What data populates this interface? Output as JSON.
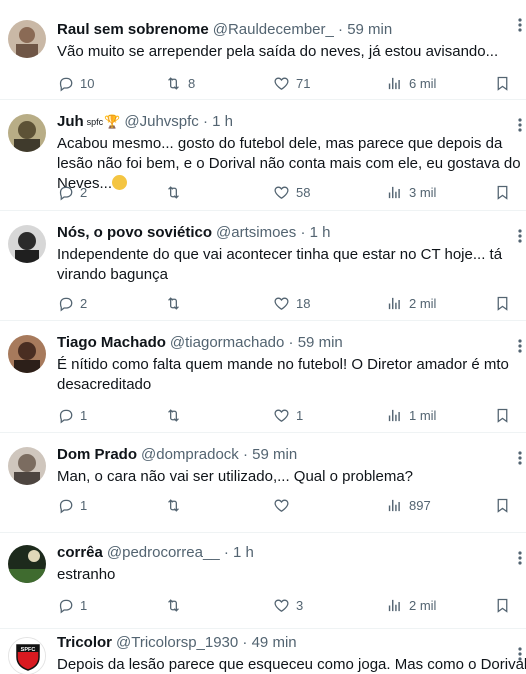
{
  "tweets": [
    {
      "name": "Raul sem sobrenome",
      "handle": "@Rauldecember_",
      "dot": "·",
      "time": "59 min",
      "text": "Vão muito se arrepender pela saída do neves, já estou avisando...",
      "replies": "10",
      "retweets": "8",
      "likes": "71",
      "views": "6 mil",
      "avatar_color": "#a58d78"
    },
    {
      "name": "Juh",
      "badge": "spfc",
      "handle": "@Juhvspfc",
      "dot": "·",
      "time": "1 h",
      "text": "Acabou mesmo... gosto do futebol dele, mas parece que depois da lesão não foi bem, e o Dorival não conta mais com ele, eu gostava do Neves...",
      "replies": "2",
      "retweets": "",
      "likes": "58",
      "views": "3 mil",
      "avatar_color": "#8e7f5c"
    },
    {
      "name": "Nós, o povo soviético",
      "handle": "@artsimoes",
      "dot": "·",
      "time": "1 h",
      "text": "Independente do que vai acontecer tinha que estar no CT hoje... tá virando bagunça",
      "replies": "2",
      "retweets": "",
      "likes": "18",
      "views": "2 mil",
      "avatar_color": "#3b3b3b"
    },
    {
      "name": "Tiago Machado",
      "handle": "@tiagormachado",
      "dot": "·",
      "time": "59 min",
      "text": "É nítido como falta quem mande no futebol! O Diretor amador é mto desacreditado",
      "replies": "1",
      "retweets": "",
      "likes": "1",
      "views": "1 mil",
      "avatar_color": "#6b4a3a"
    },
    {
      "name": "Dom Prado",
      "handle": "@dompradock",
      "dot": "·",
      "time": "59 min",
      "text": "Man, o cara não vai ser utilizado,... Qual o problema?",
      "replies": "1",
      "retweets": "",
      "likes": "",
      "views": "897",
      "avatar_color": "#9a8f85"
    },
    {
      "name": "corrêa",
      "handle": "@pedrocorrea__",
      "dot": "·",
      "time": "1 h",
      "text": "estranho",
      "replies": "1",
      "retweets": "",
      "likes": "3",
      "views": "2 mil",
      "avatar_color": "#2f3a2a"
    },
    {
      "name": "Tricolor",
      "handle": "@Tricolorsp_1930",
      "dot": "·",
      "time": "49 min",
      "text": "Depois da lesão parece que esqueceu como joga. Mas como o Dorival",
      "avatar_color": "#ffffff",
      "logo_text": "SPFC"
    }
  ],
  "icons": {
    "reply": "reply-icon",
    "retweet": "retweet-icon",
    "like": "heart-icon",
    "views": "views-icon",
    "bookmark": "bookmark-icon",
    "share": "share-icon",
    "more": "more-icon"
  },
  "colors": {
    "text": "#0f1419",
    "secondary": "#536471",
    "divider": "#eff3f4"
  }
}
